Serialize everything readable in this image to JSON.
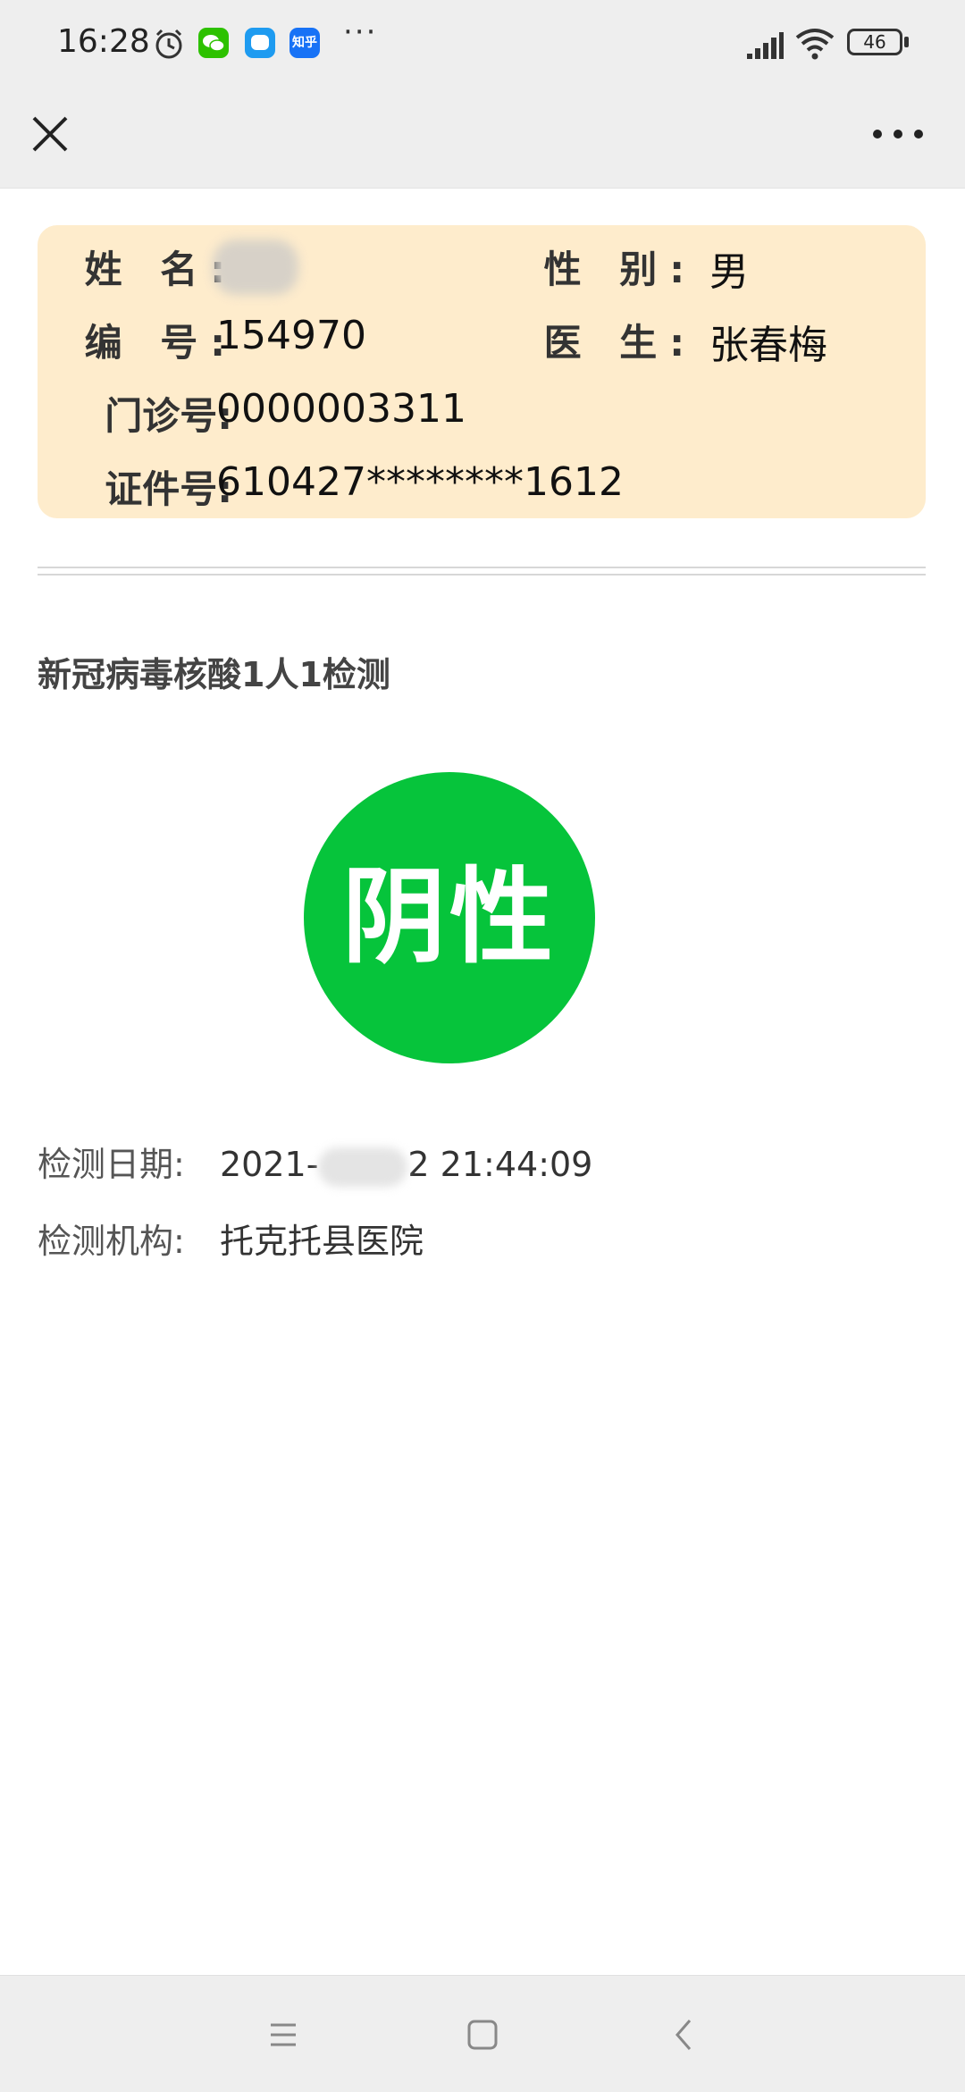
{
  "status_bar": {
    "time": "16:28",
    "notifications": [
      {
        "icon": "alarm-icon"
      },
      {
        "icon": "wechat-icon",
        "color": "#2dc100"
      },
      {
        "icon": "bubble-app-icon",
        "color": "#1e9bf0"
      },
      {
        "icon": "zhihu-icon",
        "label": "知乎",
        "color": "#1772f6"
      }
    ],
    "more": "···",
    "battery": "46"
  },
  "title_bar": {
    "close_icon": "close-icon",
    "more_icon": "more-dots-icon"
  },
  "patient": {
    "name_label": "姓  名:",
    "sex_label": "性  别:",
    "sex": "男",
    "id_label": "编  号:",
    "id": "154970",
    "doctor_label": "医  生:",
    "doctor": "张春梅",
    "clinic_label": "门诊号:",
    "clinic_no": "0000003311",
    "cert_label": "证件号:",
    "cert_no": "610427********1612"
  },
  "test": {
    "title": "新冠病毒核酸1人1检测",
    "result": "阴性",
    "result_color": "#06c43b",
    "date_label": "检测日期:",
    "date_prefix": "2021-",
    "date_suffix": "2 21:44:09",
    "org_label": "检测机构:",
    "org": "托克托县医院"
  },
  "nav_bar": {
    "buttons": [
      "menu-icon",
      "home-icon",
      "back-icon"
    ]
  }
}
